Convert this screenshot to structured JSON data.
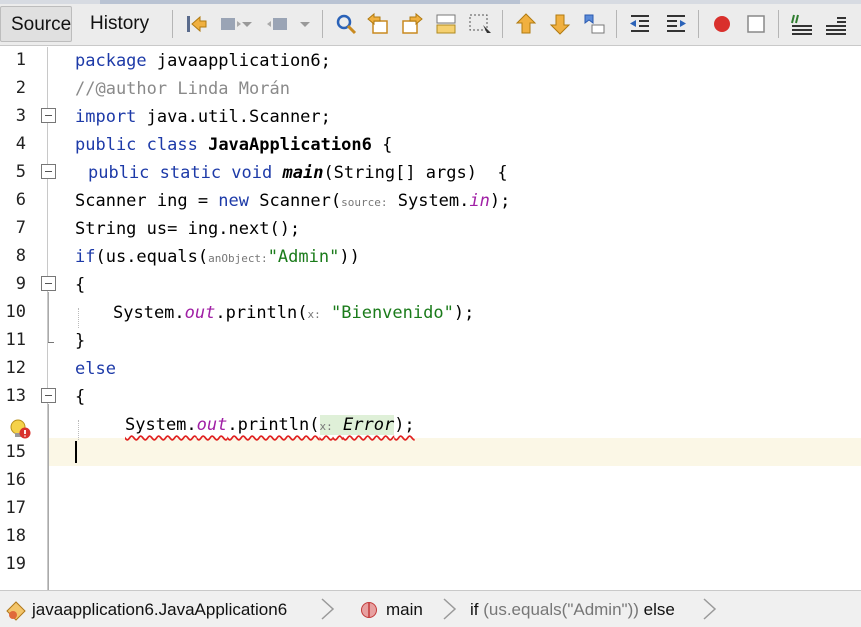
{
  "toolbar": {
    "tabs": [
      {
        "label": "Source",
        "active": true
      },
      {
        "label": "History",
        "active": false
      }
    ],
    "buttons": [
      "last-edit-icon",
      "back-icon",
      "forward-icon",
      "find-icon",
      "find-previous-icon",
      "find-next-icon",
      "toggle-highlight-icon",
      "toggle-rect-selection-icon",
      "previous-bookmark-icon",
      "next-bookmark-icon",
      "toggle-bookmark-icon",
      "shift-left-icon",
      "shift-right-icon",
      "start-macro-recording-icon",
      "stop-macro-recording-icon",
      "comment-icon",
      "uncomment-icon"
    ]
  },
  "editor": {
    "line_numbers": [
      "1",
      "2",
      "3",
      "4",
      "5",
      "6",
      "7",
      "8",
      "9",
      "10",
      "11",
      "12",
      "13",
      "14",
      "15",
      "16",
      "17",
      "18",
      "19"
    ],
    "current_line": 15,
    "error_line": 14,
    "lines": {
      "l1": {
        "kw": "package",
        "rest": " javaapplication6;"
      },
      "l2": {
        "comment": "//@author Linda Morán"
      },
      "l3": {
        "kw": "import",
        "rest": " java.util.Scanner;"
      },
      "l4": {
        "kw": "public class",
        "name": "JavaApplication6",
        "rest": " {"
      },
      "l5": {
        "kw": "public static void",
        "name": "main",
        "rest": "(String[] args)  {"
      },
      "l6": {
        "a": "Scanner ing = ",
        "kw": "new",
        "b": " Scanner(",
        "hint": "source:",
        "c": " System.",
        "field": "in",
        "d": ");"
      },
      "l7": {
        "text": "String us= ing.next();"
      },
      "l8": {
        "kw": "if",
        "a": "(us.equals(",
        "hint": "anObject:",
        "str": "\"Admin\"",
        "b": "))"
      },
      "l9": {
        "text": "{"
      },
      "l10": {
        "a": "System.",
        "field": "out",
        "b": ".println(",
        "hint": "x:",
        "str": "\"Bienvenido\"",
        "c": ");"
      },
      "l11": {
        "text": "}"
      },
      "l12": {
        "kw": "else"
      },
      "l13": {
        "text": "{"
      },
      "l14": {
        "a": "System.",
        "field": "out",
        "b": ".println(",
        "hint": "x:",
        "err": "Error",
        "c": ");"
      }
    }
  },
  "breadcrumb": {
    "items": [
      {
        "label": "javaapplication6.JavaApplication6",
        "icon": "class-icon"
      },
      {
        "label": "main",
        "icon": "method-icon"
      },
      {
        "kw": "if",
        "cond": " (us.equals(\"Admin\"))",
        "tail": " else"
      }
    ]
  }
}
